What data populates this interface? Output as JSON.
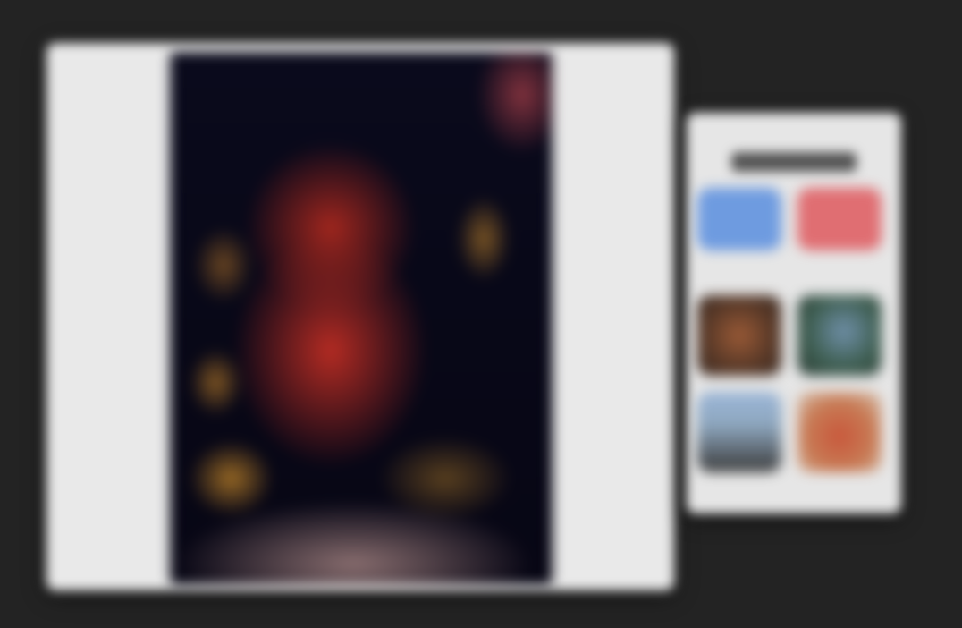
{
  "window": {
    "title": ""
  },
  "preview": {
    "poster_label": ""
  },
  "side_panel": {
    "title": "",
    "tiles": [
      {
        "name": "blue-tile",
        "color": "#6e9be0"
      },
      {
        "name": "red-tile",
        "color": "#e06e72"
      },
      {
        "name": "brown-thumbnail",
        "color": "#8b5533"
      },
      {
        "name": "teal-thumbnail",
        "color": "#4e6f66"
      },
      {
        "name": "sky-thumbnail",
        "color": "#8ea7bf"
      },
      {
        "name": "warm-thumbnail",
        "color": "#c9573b"
      }
    ]
  },
  "colors": {
    "background": "#232323",
    "panel": "#e9e9e9",
    "poster_dark": "#080818",
    "accent_red": "#b02a20"
  }
}
